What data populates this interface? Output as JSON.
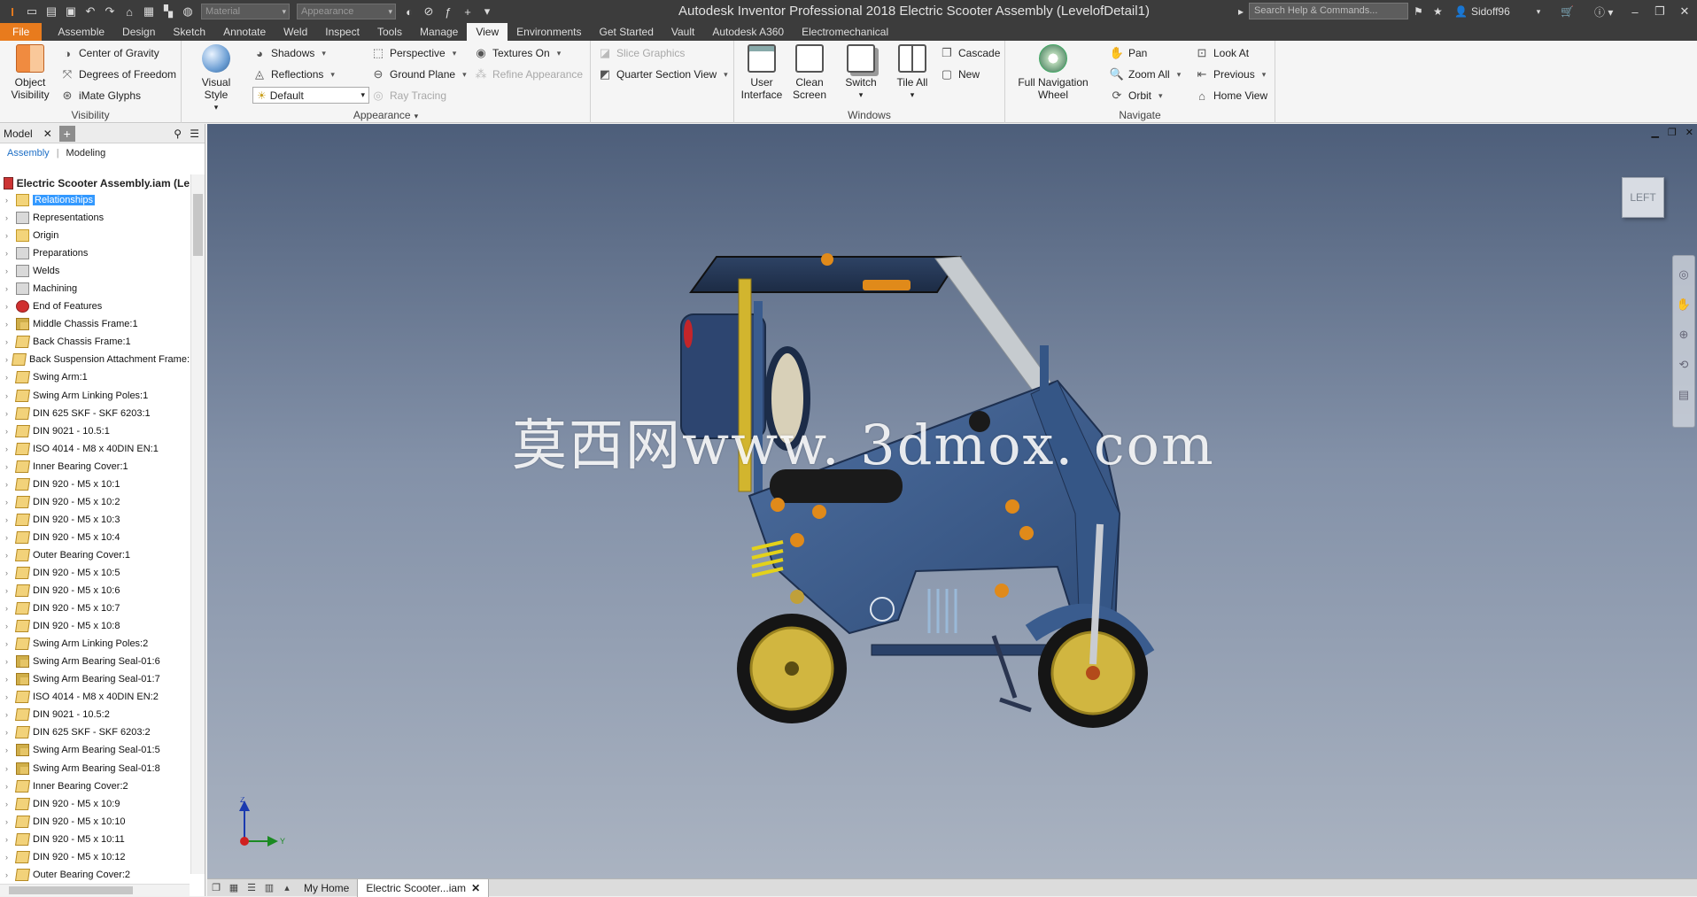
{
  "titlebar": {
    "title": "Autodesk Inventor Professional 2018    Electric Scooter Assembly (LevelofDetail1)",
    "material_placeholder": "Material",
    "appearance_placeholder": "Appearance",
    "search_placeholder": "Search Help & Commands...",
    "user": "Sidoff96"
  },
  "tabs": [
    "File",
    "Assemble",
    "Design",
    "Sketch",
    "Annotate",
    "Weld",
    "Inspect",
    "Tools",
    "Manage",
    "View",
    "Environments",
    "Get Started",
    "Vault",
    "Autodesk A360",
    "Electromechanical"
  ],
  "active_tab": "View",
  "ribbon": {
    "visibility": {
      "label": "Visibility",
      "object_visibility": "Object\nVisibility",
      "center_of_gravity": "Center of Gravity",
      "degrees_of_freedom": "Degrees of Freedom",
      "imate_glyphs": "iMate Glyphs"
    },
    "appearance": {
      "label": "Appearance",
      "visual_style": "Visual Style",
      "shadows": "Shadows",
      "reflections": "Reflections",
      "default_combo": "Default",
      "perspective": "Perspective",
      "ground_plane": "Ground Plane",
      "ray_tracing": "Ray Tracing",
      "textures_on": "Textures On",
      "refine_appearance": "Refine Appearance",
      "slice_graphics": "Slice Graphics",
      "quarter_section_view": "Quarter Section View"
    },
    "windows": {
      "label": "Windows",
      "user_interface": "User\nInterface",
      "clean_screen": "Clean\nScreen",
      "switch": "Switch",
      "tile_all": "Tile All",
      "cascade": "Cascade",
      "new": "New"
    },
    "navigate": {
      "label": "Navigate",
      "full_navigation_wheel": "Full Navigation\nWheel",
      "pan": "Pan",
      "zoom_all": "Zoom All",
      "orbit": "Orbit",
      "look_at": "Look At",
      "previous": "Previous",
      "home_view": "Home View"
    }
  },
  "browser": {
    "tab": "Model",
    "subtab_assembly": "Assembly",
    "subtab_modeling": "Modeling",
    "root": "Electric Scooter Assembly.iam (Le",
    "nodes": [
      {
        "label": "Relationships",
        "icon": "folder",
        "selected": true
      },
      {
        "label": "Representations",
        "icon": "gen"
      },
      {
        "label": "Origin",
        "icon": "folder"
      },
      {
        "label": "Preparations",
        "icon": "gen"
      },
      {
        "label": "Welds",
        "icon": "gen"
      },
      {
        "label": "Machining",
        "icon": "gen"
      },
      {
        "label": "End of Features",
        "icon": "red"
      },
      {
        "label": "Middle Chassis Frame:1",
        "icon": "sub"
      },
      {
        "label": "Back Chassis Frame:1",
        "icon": "part"
      },
      {
        "label": "Back Suspension Attachment Frame:",
        "icon": "part"
      },
      {
        "label": "Swing Arm:1",
        "icon": "part"
      },
      {
        "label": "Swing Arm Linking Poles:1",
        "icon": "part"
      },
      {
        "label": "DIN 625 SKF - SKF 6203:1",
        "icon": "part"
      },
      {
        "label": "DIN 9021 - 10.5:1",
        "icon": "part"
      },
      {
        "label": "ISO 4014 - M8 x 40DIN EN:1",
        "icon": "part"
      },
      {
        "label": "Inner Bearing  Cover:1",
        "icon": "part"
      },
      {
        "label": "DIN 920 - M5 x 10:1",
        "icon": "part"
      },
      {
        "label": "DIN 920 - M5 x 10:2",
        "icon": "part"
      },
      {
        "label": "DIN 920 - M5 x 10:3",
        "icon": "part"
      },
      {
        "label": "DIN 920 - M5 x 10:4",
        "icon": "part"
      },
      {
        "label": "Outer Bearing Cover:1",
        "icon": "part"
      },
      {
        "label": "DIN 920 - M5 x 10:5",
        "icon": "part"
      },
      {
        "label": "DIN 920 - M5 x 10:6",
        "icon": "part"
      },
      {
        "label": "DIN 920 - M5 x 10:7",
        "icon": "part"
      },
      {
        "label": "DIN 920 - M5 x 10:8",
        "icon": "part"
      },
      {
        "label": "Swing Arm Linking Poles:2",
        "icon": "part"
      },
      {
        "label": "Swing Arm Bearing Seal-01:6",
        "icon": "sub"
      },
      {
        "label": "Swing Arm Bearing Seal-01:7",
        "icon": "sub"
      },
      {
        "label": "ISO 4014 - M8 x 40DIN EN:2",
        "icon": "part"
      },
      {
        "label": "DIN 9021 - 10.5:2",
        "icon": "part"
      },
      {
        "label": "DIN 625 SKF - SKF 6203:2",
        "icon": "part"
      },
      {
        "label": "Swing Arm Bearing Seal-01:5",
        "icon": "sub"
      },
      {
        "label": "Swing Arm Bearing Seal-01:8",
        "icon": "sub"
      },
      {
        "label": "Inner Bearing  Cover:2",
        "icon": "part"
      },
      {
        "label": "DIN 920 - M5 x 10:9",
        "icon": "part"
      },
      {
        "label": "DIN 920 - M5 x 10:10",
        "icon": "part"
      },
      {
        "label": "DIN 920 - M5 x 10:11",
        "icon": "part"
      },
      {
        "label": "DIN 920 - M5 x 10:12",
        "icon": "part"
      },
      {
        "label": "Outer Bearing Cover:2",
        "icon": "part"
      }
    ]
  },
  "viewport": {
    "viewcube_label": "LEFT",
    "watermark": "莫西网www. 3dmox. com",
    "axis_z": "Z",
    "axis_y": "Y"
  },
  "docbar": {
    "home_tab": "My Home",
    "doc_tab": "Electric Scooter...iam"
  },
  "colors": {
    "file_tab": "#e87b1d",
    "selection": "#3399ff",
    "scooter_body": "#3f5f8f",
    "accent_orange": "#e08a1a"
  }
}
